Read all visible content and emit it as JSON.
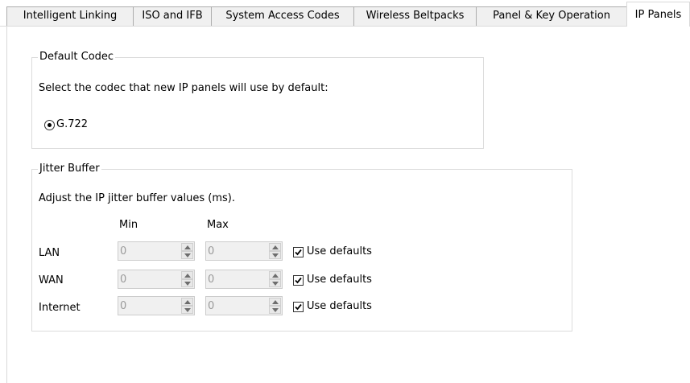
{
  "tabs": [
    {
      "label": "Intelligent Linking",
      "active": false
    },
    {
      "label": "ISO and IFB",
      "active": false
    },
    {
      "label": "System Access Codes",
      "active": false
    },
    {
      "label": "Wireless Beltpacks",
      "active": false
    },
    {
      "label": "Panel & Key Operation",
      "active": false
    },
    {
      "label": "IP Panels",
      "active": true
    }
  ],
  "default_codec": {
    "legend": "Default Codec",
    "description": "Select the codec that new IP panels will use by default:",
    "option_label": "G.722",
    "option_selected": true
  },
  "jitter_buffer": {
    "legend": "Jitter Buffer",
    "description": "Adjust the IP jitter buffer values (ms).",
    "col_min": "Min",
    "col_max": "Max",
    "rows": [
      {
        "label": "LAN",
        "min": "0",
        "max": "0",
        "use_defaults_label": "Use defaults",
        "use_defaults": true
      },
      {
        "label": "WAN",
        "min": "0",
        "max": "0",
        "use_defaults_label": "Use defaults",
        "use_defaults": true
      },
      {
        "label": "Internet",
        "min": "0",
        "max": "0",
        "use_defaults_label": "Use defaults",
        "use_defaults": true
      }
    ]
  }
}
